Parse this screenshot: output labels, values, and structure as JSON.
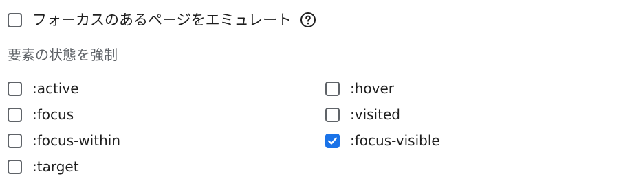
{
  "emulate_focus": {
    "label": "フォーカスのあるページをエミュレート",
    "checked": false,
    "help_icon": "question-circle-icon"
  },
  "force_state": {
    "title": "要素の状態を強制",
    "left_column": [
      {
        "label": ":active",
        "checked": false
      },
      {
        "label": ":focus",
        "checked": false
      },
      {
        "label": ":focus-within",
        "checked": false
      },
      {
        "label": ":target",
        "checked": false
      }
    ],
    "right_column": [
      {
        "label": ":hover",
        "checked": false
      },
      {
        "label": ":visited",
        "checked": false
      },
      {
        "label": ":focus-visible",
        "checked": true
      }
    ]
  },
  "colors": {
    "checkbox_checked": "#1a73e8",
    "checkbox_border": "#5f6368",
    "section_title": "#5f6368"
  }
}
